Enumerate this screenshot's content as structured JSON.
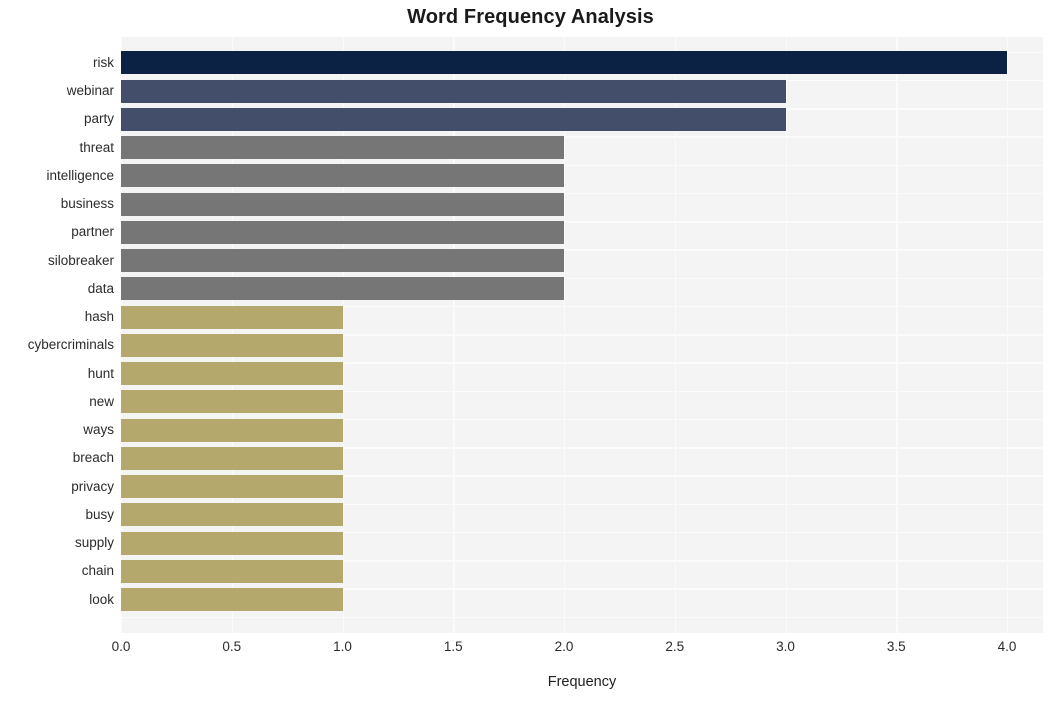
{
  "chart_data": {
    "type": "bar",
    "orientation": "horizontal",
    "title": "Word Frequency Analysis",
    "xlabel": "Frequency",
    "ylabel": "",
    "categories": [
      "risk",
      "webinar",
      "party",
      "threat",
      "intelligence",
      "business",
      "partner",
      "silobreaker",
      "data",
      "hash",
      "cybercriminals",
      "hunt",
      "new",
      "ways",
      "breach",
      "privacy",
      "busy",
      "supply",
      "chain",
      "look"
    ],
    "values": [
      4,
      3,
      3,
      2,
      2,
      2,
      2,
      2,
      2,
      1,
      1,
      1,
      1,
      1,
      1,
      1,
      1,
      1,
      1,
      1
    ],
    "bar_colors": [
      "#0c2244",
      "#434e6b",
      "#434e6b",
      "#767676",
      "#767676",
      "#767676",
      "#767676",
      "#767676",
      "#767676",
      "#b5a86d",
      "#b5a86d",
      "#b5a86d",
      "#b5a86d",
      "#b5a86d",
      "#b5a86d",
      "#b5a86d",
      "#b5a86d",
      "#b5a86d",
      "#b5a86d",
      "#b5a86d"
    ],
    "xlim": [
      0,
      4.0
    ],
    "xticks": [
      0.0,
      0.5,
      1.0,
      1.5,
      2.0,
      2.5,
      3.0,
      3.5,
      4.0
    ],
    "xtick_labels": [
      "0.0",
      "0.5",
      "1.0",
      "1.5",
      "2.0",
      "2.5",
      "3.0",
      "3.5",
      "4.0"
    ],
    "grid": true,
    "grid_color": "#fbfbfb",
    "plot_background": "#f4f4f4",
    "figure_background": "#ffffff",
    "legend": null
  }
}
